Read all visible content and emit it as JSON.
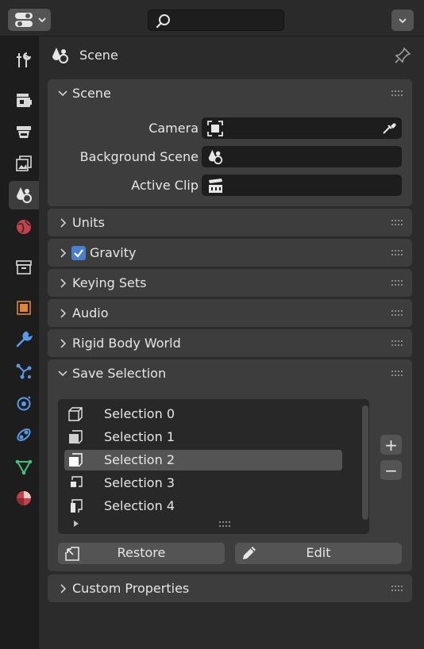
{
  "header": {
    "editor_icon": "properties-editor-icon",
    "search_icon": "search-icon",
    "collapse_icon": "chevron-down-icon"
  },
  "tabs": [
    {
      "name": "tool",
      "icon": "tool-icon"
    },
    {
      "name": "render",
      "icon": "render-icon"
    },
    {
      "name": "output",
      "icon": "output-icon"
    },
    {
      "name": "view-layer",
      "icon": "view-layer-icon"
    },
    {
      "name": "scene",
      "icon": "scene-icon",
      "active": true
    },
    {
      "name": "world",
      "icon": "world-icon"
    },
    {
      "name": "collection",
      "icon": "collection-icon"
    },
    {
      "name": "object",
      "icon": "object-icon"
    },
    {
      "name": "modifiers",
      "icon": "wrench-icon"
    },
    {
      "name": "particles",
      "icon": "particles-icon"
    },
    {
      "name": "physics",
      "icon": "physics-icon"
    },
    {
      "name": "constraints",
      "icon": "constraints-icon"
    },
    {
      "name": "data",
      "icon": "mesh-data-icon"
    },
    {
      "name": "material",
      "icon": "material-icon"
    }
  ],
  "context": {
    "label": "Scene",
    "pin_icon": "pin-icon"
  },
  "scene_panel": {
    "title": "Scene",
    "fields": [
      {
        "label": "Camera",
        "icon": "camera-icon",
        "value": ""
      },
      {
        "label": "Background Scene",
        "icon": "scene-icon",
        "value": ""
      },
      {
        "label": "Active Clip",
        "icon": "clip-icon",
        "value": ""
      }
    ]
  },
  "panels": [
    {
      "title": "Units"
    },
    {
      "title": "Gravity",
      "checked": true
    },
    {
      "title": "Keying Sets"
    },
    {
      "title": "Audio"
    },
    {
      "title": "Rigid Body World"
    }
  ],
  "save_selection": {
    "title": "Save Selection",
    "items": [
      {
        "label": "Selection 0"
      },
      {
        "label": "Selection 1"
      },
      {
        "label": "Selection 2",
        "selected": true
      },
      {
        "label": "Selection 3"
      },
      {
        "label": "Selection 4"
      }
    ],
    "add_label": "+",
    "remove_label": "−",
    "restore_label": "Restore",
    "edit_label": "Edit"
  },
  "custom_properties": {
    "title": "Custom Properties"
  },
  "colors": {
    "accent": "#4a7fd0",
    "panel_bg": "#3d3d3d",
    "field_bg": "#1d1d1d",
    "button_bg": "#545454"
  }
}
